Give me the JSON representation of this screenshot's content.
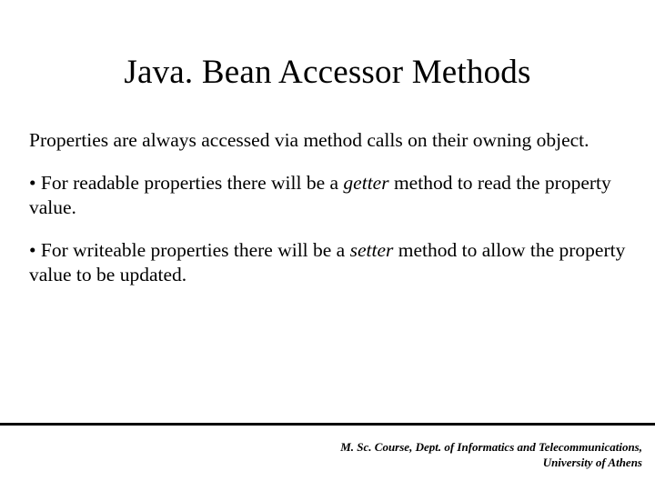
{
  "title": "Java. Bean Accessor Methods",
  "intro": "Properties are always accessed via method calls on their owning object.",
  "bullets": [
    {
      "prefix": "• For readable properties there will be a ",
      "em": "getter",
      "suffix": " method to read the property value."
    },
    {
      "prefix": "• For writeable properties there will be a ",
      "em": "setter",
      "suffix": " method to allow the property value to be updated."
    }
  ],
  "footer": {
    "line1": "M. Sc. Course, Dept. of Informatics and Telecommunications,",
    "line2": "University of Athens"
  }
}
